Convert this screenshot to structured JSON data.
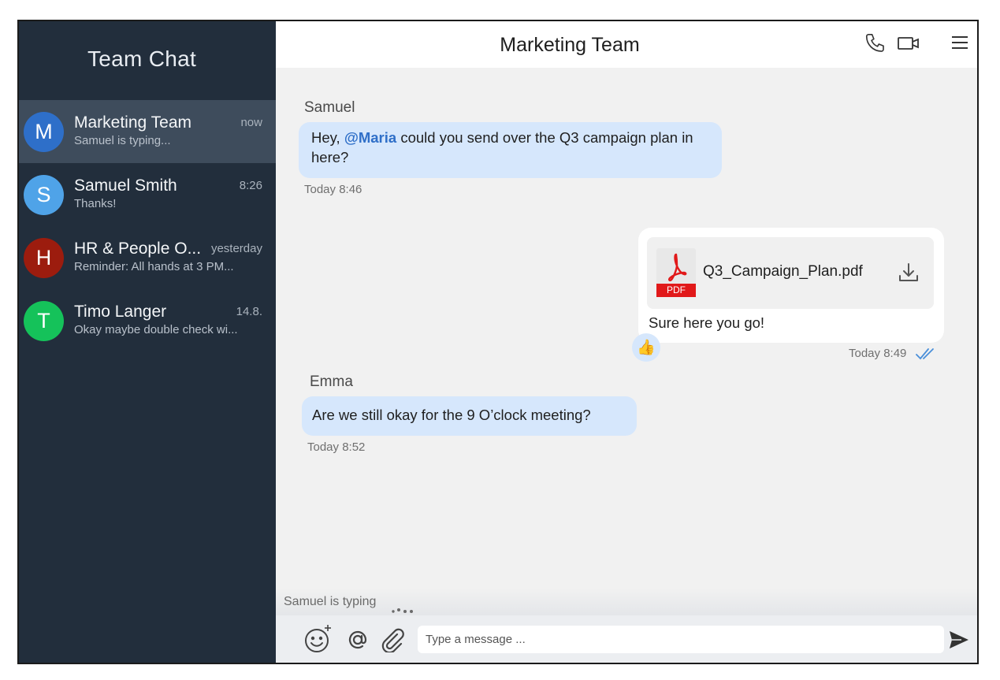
{
  "sidebar": {
    "title": "Team Chat",
    "conversations": [
      {
        "initial": "M",
        "name": "Marketing Team",
        "preview": "Samuel is typing...",
        "time": "now",
        "color": "#2e6fc9",
        "active": true
      },
      {
        "initial": "S",
        "name": "Samuel Smith",
        "preview": "Thanks!",
        "time": "8:26",
        "color": "#4fa3e8"
      },
      {
        "initial": "H",
        "name": "HR & People O...",
        "preview": "Reminder: All hands at 3 PM...",
        "time": "yesterday",
        "color": "#9c1c0e"
      },
      {
        "initial": "T",
        "name": "Timo Langer",
        "preview": "Okay maybe double check wi...",
        "time": "14.8.",
        "color": "#15c25a"
      }
    ]
  },
  "header": {
    "title": "Marketing Team",
    "icons": [
      "phone-icon",
      "video-camera-icon",
      "menu-icon"
    ]
  },
  "messages": {
    "m1": {
      "sender": "Samuel",
      "text_before": "Hey, ",
      "mention": "@Maria",
      "text_after": " could you send over the Q3 campaign plan in here?",
      "time": "Today 8:46"
    },
    "m2": {
      "file_name": "Q3_Campaign_Plan.pdf",
      "file_type": "PDF",
      "caption": "Sure here you go!",
      "time": "Today 8:49",
      "reaction": "👍",
      "status": "read-double-check"
    },
    "m3": {
      "sender": "Emma",
      "text": "Are we still okay for the 9 O’clock meeting?",
      "time": "Today 8:52"
    }
  },
  "typing": {
    "text": "Samuel is typing"
  },
  "composer": {
    "placeholder": "Type a message ...",
    "icons": [
      "emoji-add-icon",
      "mention-icon",
      "attachment-icon",
      "send-icon"
    ]
  },
  "colors": {
    "sidebar_bg": "#222e3c",
    "active_item": "#3e4c5c",
    "bubble": "#d6e7fc",
    "mention": "#2f6fc8",
    "pdf_red": "#e1191a"
  }
}
